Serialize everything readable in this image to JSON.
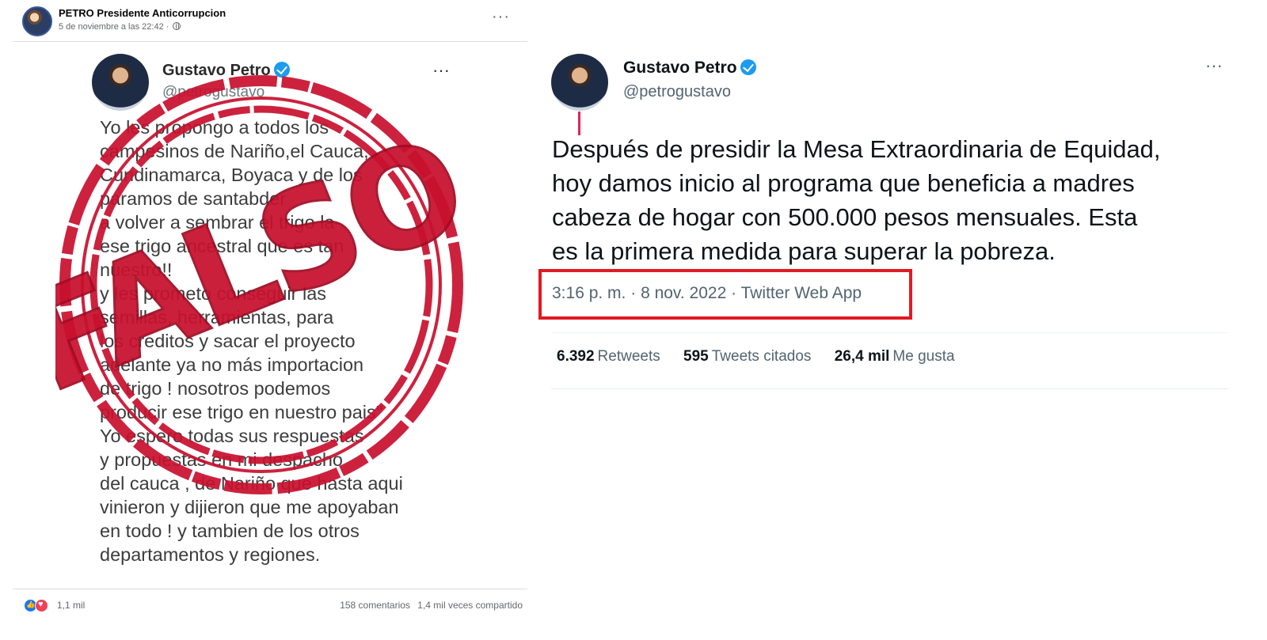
{
  "facebook": {
    "page_name": "PETRO Presidente Anticorrupcion",
    "post_date": "5 de noviembre a las 22:42 ·",
    "more": "···",
    "reactions_count": "1,1 mil",
    "comments": "158 comentarios",
    "shares": "1,4 mil veces compartido"
  },
  "fake_tweet": {
    "name": "Gustavo Petro",
    "handle": "@petrogustavo",
    "more": "···",
    "lines": [
      "Yo les propongo a todos los",
      "campesinos de Nariño,el Cauca,",
      "Cundinamarca, Boyaca y de los",
      "paramos de santabder",
      "a volver a sembrar el trigo la",
      "ese trigo ancestral que es tan",
      "nuestro!!",
      "y les prometo conseguir las",
      "semillas, herramientas, para",
      "los creditos y sacar el proyecto",
      "adelante ya no más importacion",
      "de trigo ! nosotros podemos",
      "producir ese trigo en nuestro pais\"",
      "Yo espero todas sus respuestas",
      "y propuestas en mi despacho",
      "del cauca , de Nariño que hasta aqui",
      "vinieron y dijieron que me apoyaban",
      "en todo ! y tambien de los otros",
      "departamentos y regiones."
    ],
    "stamp_text": "FALSO",
    "stamp_color": "#c8102e"
  },
  "real_tweet": {
    "name": "Gustavo Petro",
    "handle": "@petrogustavo",
    "more": "···",
    "lines": [
      "Después de presidir la Mesa Extraordinaria de Equidad,",
      "hoy damos inicio al programa que beneficia a madres",
      "cabeza de hogar con 500.000 pesos mensuales. Esta",
      "es la primera medida para superar la pobreza."
    ],
    "time": "3:16 p. m.",
    "date": "8 nov. 2022",
    "source": "Twitter Web App",
    "highlight_color": "#e11a22",
    "stats": [
      {
        "value": "6.392",
        "label": "Retweets"
      },
      {
        "value": "595",
        "label": "Tweets citados"
      },
      {
        "value": "26,4 mil",
        "label": "Me gusta"
      }
    ]
  },
  "colors": {
    "verified": "#1d9bf0",
    "facebook_blue": "#1877f2",
    "love_red": "#f33e58"
  }
}
